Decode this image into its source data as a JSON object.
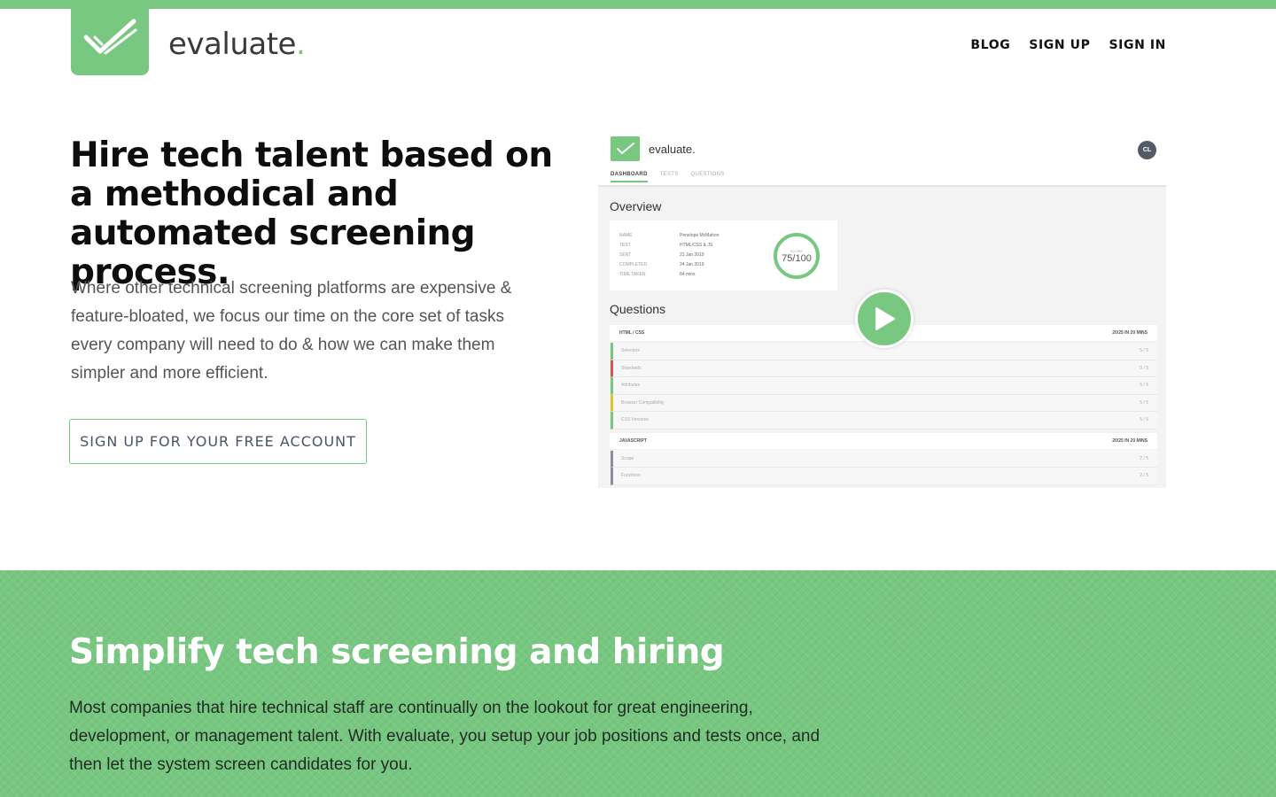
{
  "brand": {
    "name": "evaluate",
    "dot": ".",
    "color": "#79c882"
  },
  "nav": {
    "items": [
      "BLOG",
      "SIGN UP",
      "SIGN IN"
    ]
  },
  "hero": {
    "title": "Hire tech talent based on a methodical and automated screening process.",
    "description": "Where other technical screening platforms are expensive & feature-bloated, we focus our time on the core set of tasks every company will need to do & how we can make them simpler and more efficient.",
    "cta_label": "SIGN UP FOR YOUR FREE ACCOUNT"
  },
  "preview": {
    "logo_text": "evaluate.",
    "avatar": "CL",
    "tabs": [
      "DASHBOARD",
      "TESTS",
      "QUESTIONS"
    ],
    "overview_title": "Overview",
    "overview": [
      {
        "key": "NAME",
        "value": "Penelope McMahon"
      },
      {
        "key": "TEST",
        "value": "HTML/CSS & JS"
      },
      {
        "key": "SENT",
        "value": "21 Jan 2019"
      },
      {
        "key": "COMPLETED",
        "value": "24 Jan 2019"
      },
      {
        "key": "TIME TAKEN",
        "value": "84 mins"
      }
    ],
    "score_label": "SCORE",
    "score": "75/100",
    "questions_title": "Questions",
    "groups": [
      {
        "name": "HTML / CSS",
        "summary": "20/25 IN 20 MINS",
        "rows": [
          {
            "name": "Selectors",
            "score": "5 / 5",
            "status": "green"
          },
          {
            "name": "Standards",
            "score": "0 / 5",
            "status": "red"
          },
          {
            "name": "Attributes",
            "score": "5 / 5",
            "status": "green"
          },
          {
            "name": "Browser Compatibility",
            "score": "5 / 5",
            "status": "yellow"
          },
          {
            "name": "CSS Versions",
            "score": "5 / 5",
            "status": "green"
          }
        ]
      },
      {
        "name": "JAVASCRIPT",
        "summary": "20/25 IN 20 MINS",
        "rows": [
          {
            "name": "Scope",
            "score": "2 / 5",
            "status": "grey"
          },
          {
            "name": "Functions",
            "score": "2 / 5",
            "status": "grey"
          }
        ]
      }
    ]
  },
  "section2": {
    "title": "Simplify tech screening and hiring",
    "description": "Most companies that hire technical staff are continually on the lookout for great engineering, development, or management talent. With evaluate, you setup your job positions and tests once, and then let the system screen candidates for you."
  }
}
